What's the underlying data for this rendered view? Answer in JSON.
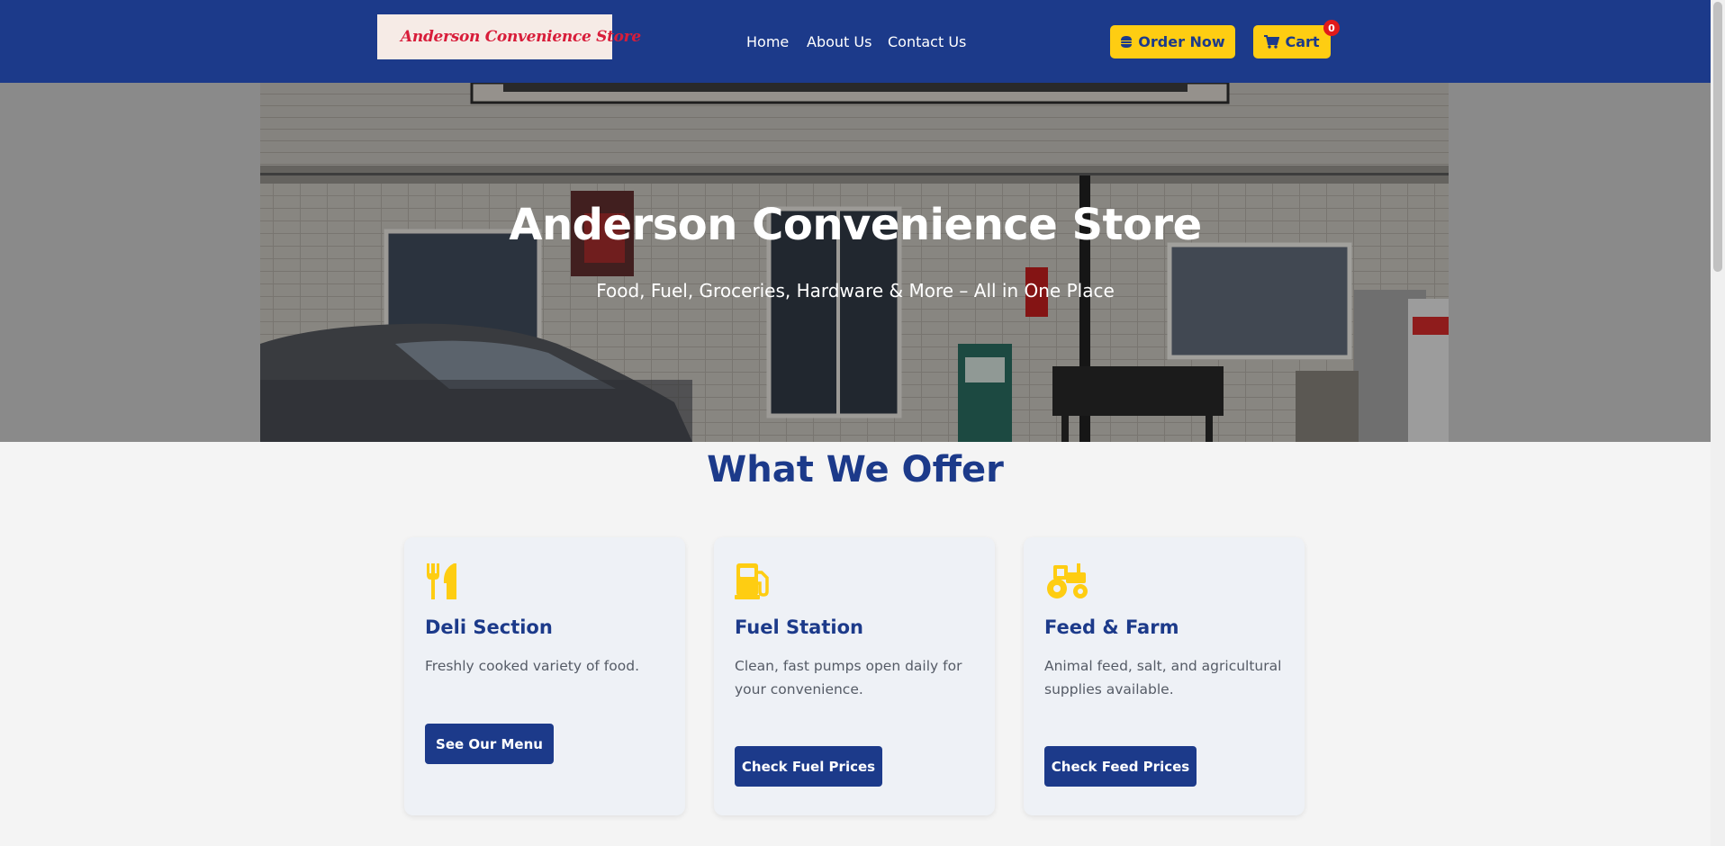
{
  "header": {
    "logo_text": "Anderson Convenience Store",
    "nav": [
      {
        "label": "Home"
      },
      {
        "label": "About Us"
      },
      {
        "label": "Contact Us"
      }
    ],
    "order_label": "Order Now",
    "cart_label": "Cart",
    "cart_count": "0"
  },
  "hero": {
    "title": "Anderson Convenience Store",
    "subtitle": "Food, Fuel, Groceries, Hardware & More – All in One Place"
  },
  "offer": {
    "title": "What We Offer",
    "cards": [
      {
        "icon": "utensils-icon",
        "title": "Deli Section",
        "desc": "Freshly cooked variety of food.",
        "button": "See Our Menu"
      },
      {
        "icon": "gas-pump-icon",
        "title": "Fuel Station",
        "desc": "Clean, fast pumps open daily for your convenience.",
        "button": "Check Fuel Prices"
      },
      {
        "icon": "tractor-icon",
        "title": "Feed & Farm",
        "desc": "Animal feed, salt, and agricultural supplies available.",
        "button": "Check Feed Prices"
      }
    ]
  },
  "colors": {
    "brand_blue": "#1c3a8a",
    "accent_yellow": "#fecd12",
    "badge_red": "#e11a1a",
    "logo_red": "#d81d3a"
  }
}
